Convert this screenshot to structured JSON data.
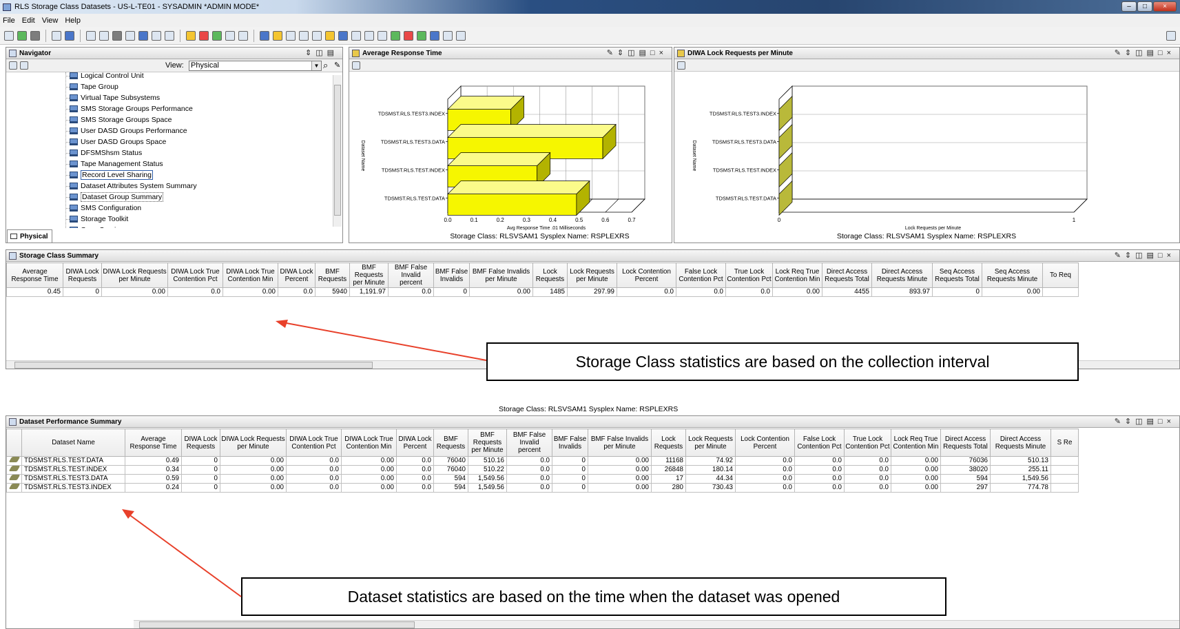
{
  "window": {
    "title": "RLS Storage Class Datasets - US-L-TE01 - SYSADMIN  *ADMIN MODE*",
    "controls": [
      "–",
      "□",
      "×"
    ]
  },
  "menu": [
    "File",
    "Edit",
    "View",
    "Help"
  ],
  "navigator": {
    "title": "Navigator",
    "view_label": "View:",
    "view_value": "Physical",
    "tab_label": "Physical",
    "items": [
      {
        "label": "Logical Control Unit"
      },
      {
        "label": "Tape Group"
      },
      {
        "label": "Virtual Tape Subsystems"
      },
      {
        "label": "SMS Storage Groups Performance"
      },
      {
        "label": "SMS Storage Groups Space"
      },
      {
        "label": "User DASD Groups Performance"
      },
      {
        "label": "User DASD Groups Space"
      },
      {
        "label": "DFSMShsm Status"
      },
      {
        "label": "Tape Management Status"
      },
      {
        "label": "Record Level Sharing",
        "state": "selected"
      },
      {
        "label": "Dataset Attributes System Summary"
      },
      {
        "label": "Dataset Group Summary",
        "state": "focus"
      },
      {
        "label": "SMS Configuration"
      },
      {
        "label": "Storage Toolkit"
      },
      {
        "label": "Copy Services"
      }
    ]
  },
  "response_panel": {
    "title": "Average Response Time",
    "footer": "Storage Class: RLSVSAM1   Sysplex Name: RSPLEXRS"
  },
  "lock_panel": {
    "title": "DIWA Lock Requests per Minute",
    "footer": "Storage Class: RLSVSAM1   Sysplex Name: RSPLEXRS"
  },
  "chart_data": [
    {
      "type": "bar",
      "orientation": "horizontal",
      "categories": [
        "TDSMST.RLS.TEST3.INDEX",
        "TDSMST.RLS.TEST3.DATA",
        "TDSMST.RLS.TEST.INDEX",
        "TDSMST.RLS.TEST.DATA"
      ],
      "values": [
        0.24,
        0.59,
        0.34,
        0.49
      ],
      "xlabel": "Avg Response Time .01 Milliseconds",
      "ylabel": "Dataset Name",
      "xlim": [
        0,
        0.7
      ],
      "xticks": [
        "0.0",
        "0.1",
        "0.2",
        "0.3",
        "0.4",
        "0.5",
        "0.6",
        "0.7"
      ],
      "color": "#f6f600",
      "grid": true
    },
    {
      "type": "bar",
      "orientation": "horizontal",
      "categories": [
        "TDSMST.RLS.TEST3.INDEX",
        "TDSMST.RLS.TEST3.DATA",
        "TDSMST.RLS.TEST.INDEX",
        "TDSMST.RLS.TEST.DATA"
      ],
      "values": [
        0,
        0,
        0,
        0
      ],
      "xlabel": "Lock Requests per Minute",
      "ylabel": "Dataset Name",
      "xlim": [
        0,
        1
      ],
      "xticks": [
        "0",
        "1"
      ],
      "color": "#b9b93a",
      "grid": true
    }
  ],
  "storage_summary": {
    "title": "Storage Class Summary",
    "columns": [
      "Average Response Time",
      "DIWA Lock Requests",
      "DIWA Lock Requests per Minute",
      "DIWA Lock True Contention Pct",
      "DIWA Lock True Contention Min",
      "DIWA Lock Percent",
      "BMF Requests",
      "BMF Requests per Minute",
      "BMF False Invalid percent",
      "BMF False Invalids",
      "BMF False Invalids per Minute",
      "Lock Requests",
      "Lock Requests per Minute",
      "Lock Contention Percent",
      "False Lock Contention Pct",
      "True Lock Contention Pct",
      "Lock Req True Contention Min",
      "Direct Access Requests Total",
      "Direct Access Requests Minute",
      "Seq Access Requests Total",
      "Seq Access Requests Minute",
      "To Req"
    ],
    "rows": [
      [
        "0.45",
        "0",
        "0.00",
        "0.0",
        "0.00",
        "0.0",
        "5940",
        "1,191.97",
        "0.0",
        "0",
        "0.00",
        "1485",
        "297.99",
        "0.0",
        "0.0",
        "0.0",
        "0.00",
        "4455",
        "893.97",
        "0",
        "0.00",
        ""
      ]
    ],
    "callout": "Storage Class statistics are based on the collection interval",
    "footer": "Storage Class: RLSVSAM1    Sysplex Name: RSPLEXRS"
  },
  "dataset_summary": {
    "title": "Dataset Performance Summary",
    "columns": [
      "",
      "Dataset Name",
      "Average Response Time",
      "DIWA Lock Requests",
      "DIWA Lock Requests per Minute",
      "DIWA Lock True Contention Pct",
      "DIWA Lock True Contention Min",
      "DIWA Lock Percent",
      "BMF Requests",
      "BMF Requests per Minute",
      "BMF False Invalid percent",
      "BMF False Invalids",
      "BMF False Invalids per Minute",
      "Lock Requests",
      "Lock Requests per Minute",
      "Lock Contention Percent",
      "False Lock Contention Pct",
      "True Lock Contention Pct",
      "Lock Req True Contention Min",
      "Direct Access Requests Total",
      "Direct Access Requests Minute",
      "S Re"
    ],
    "rows": [
      [
        "",
        "TDSMST.RLS.TEST.DATA",
        "0.49",
        "0",
        "0.00",
        "0.0",
        "0.00",
        "0.0",
        "76040",
        "510.16",
        "0.0",
        "0",
        "0.00",
        "11168",
        "74.92",
        "0.0",
        "0.0",
        "0.0",
        "0.00",
        "76036",
        "510.13",
        ""
      ],
      [
        "",
        "TDSMST.RLS.TEST.INDEX",
        "0.34",
        "0",
        "0.00",
        "0.0",
        "0.00",
        "0.0",
        "76040",
        "510.22",
        "0.0",
        "0",
        "0.00",
        "26848",
        "180.14",
        "0.0",
        "0.0",
        "0.0",
        "0.00",
        "38020",
        "255.11",
        ""
      ],
      [
        "",
        "TDSMST.RLS.TEST3.DATA",
        "0.59",
        "0",
        "0.00",
        "0.0",
        "0.00",
        "0.0",
        "594",
        "1,549.56",
        "0.0",
        "0",
        "0.00",
        "17",
        "44.34",
        "0.0",
        "0.0",
        "0.0",
        "0.00",
        "594",
        "1,549.56",
        ""
      ],
      [
        "",
        "TDSMST.RLS.TEST3.INDEX",
        "0.24",
        "0",
        "0.00",
        "0.0",
        "0.00",
        "0.0",
        "594",
        "1,549.56",
        "0.0",
        "0",
        "0.00",
        "280",
        "730.43",
        "0.0",
        "0.0",
        "0.0",
        "0.00",
        "297",
        "774.78",
        ""
      ]
    ],
    "callout": "Dataset statistics are based on the time when the dataset was opened"
  }
}
